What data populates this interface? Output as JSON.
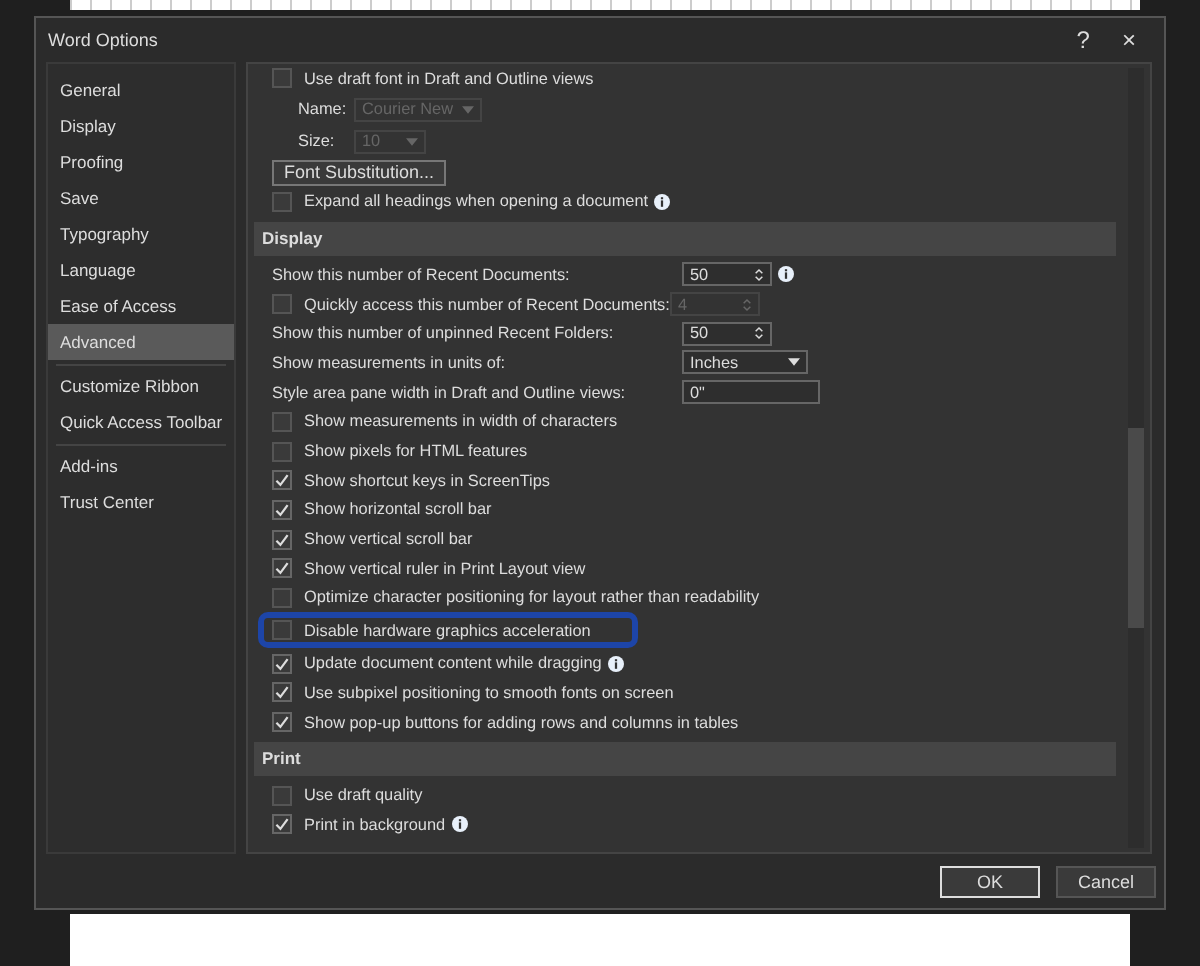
{
  "window": {
    "title": "Word Options",
    "help": "?",
    "close": "×"
  },
  "sidebar": {
    "groups": [
      {
        "items": [
          {
            "label": "General",
            "selected": false
          },
          {
            "label": "Display",
            "selected": false
          },
          {
            "label": "Proofing",
            "selected": false
          },
          {
            "label": "Save",
            "selected": false
          },
          {
            "label": "Typography",
            "selected": false
          },
          {
            "label": "Language",
            "selected": false
          },
          {
            "label": "Ease of Access",
            "selected": false
          },
          {
            "label": "Advanced",
            "selected": true
          }
        ]
      },
      {
        "items": [
          {
            "label": "Customize Ribbon",
            "selected": false
          },
          {
            "label": "Quick Access Toolbar",
            "selected": false
          }
        ]
      },
      {
        "items": [
          {
            "label": "Add-ins",
            "selected": false
          },
          {
            "label": "Trust Center",
            "selected": false
          }
        ]
      }
    ]
  },
  "content": {
    "items": [
      {
        "kind": "checkbox",
        "label": "Use draft font in Draft and Outline views",
        "checked": false
      },
      {
        "kind": "select",
        "label": "Name:",
        "value": "Courier New",
        "disabled": true,
        "indent": true
      },
      {
        "kind": "select",
        "label": "Size:",
        "value": "10",
        "disabled": true,
        "indent": true
      },
      {
        "kind": "button",
        "label": "Font Substitution..."
      },
      {
        "kind": "checkbox",
        "label": "Expand all headings when opening a document",
        "checked": false,
        "info": true
      },
      {
        "kind": "section",
        "label": "Display"
      },
      {
        "kind": "spinner",
        "label": "Show this number of Recent Documents:",
        "value": "50",
        "disabled": false,
        "info": true
      },
      {
        "kind": "checkbox-spinner",
        "label": "Quickly access this number of Recent Documents:",
        "checked": false,
        "value": "4",
        "disabled": true
      },
      {
        "kind": "spinner",
        "label": "Show this number of unpinned Recent Folders:",
        "value": "50",
        "disabled": false
      },
      {
        "kind": "select",
        "label": "Show measurements in units of:",
        "value": "Inches",
        "disabled": false
      },
      {
        "kind": "text",
        "label": "Style area pane width in Draft and Outline views:",
        "value": "0\""
      },
      {
        "kind": "checkbox",
        "label": "Show measurements in width of characters",
        "checked": false
      },
      {
        "kind": "checkbox",
        "label": "Show pixels for HTML features",
        "checked": false
      },
      {
        "kind": "checkbox",
        "label": "Show shortcut keys in ScreenTips",
        "checked": true
      },
      {
        "kind": "checkbox",
        "label": "Show horizontal scroll bar",
        "checked": true
      },
      {
        "kind": "checkbox",
        "label": "Show vertical scroll bar",
        "checked": true
      },
      {
        "kind": "checkbox",
        "label": "Show vertical ruler in Print Layout view",
        "checked": true
      },
      {
        "kind": "checkbox",
        "label": "Optimize character positioning for layout rather than readability",
        "checked": false
      },
      {
        "kind": "checkbox",
        "label": "Disable hardware graphics acceleration",
        "checked": false,
        "highlighted": true
      },
      {
        "kind": "checkbox",
        "label": "Update document content while dragging",
        "checked": true,
        "info": true
      },
      {
        "kind": "checkbox",
        "label": "Use subpixel positioning to smooth fonts on screen",
        "checked": true
      },
      {
        "kind": "checkbox",
        "label": "Show pop-up buttons for adding rows and columns in tables",
        "checked": true
      },
      {
        "kind": "section",
        "label": "Print"
      },
      {
        "kind": "checkbox",
        "label": "Use draft quality",
        "checked": false
      },
      {
        "kind": "checkbox",
        "label": "Print in background",
        "checked": true,
        "info": true
      }
    ]
  },
  "buttons": [
    {
      "label": "OK",
      "default": true
    },
    {
      "label": "Cancel",
      "default": false
    }
  ]
}
